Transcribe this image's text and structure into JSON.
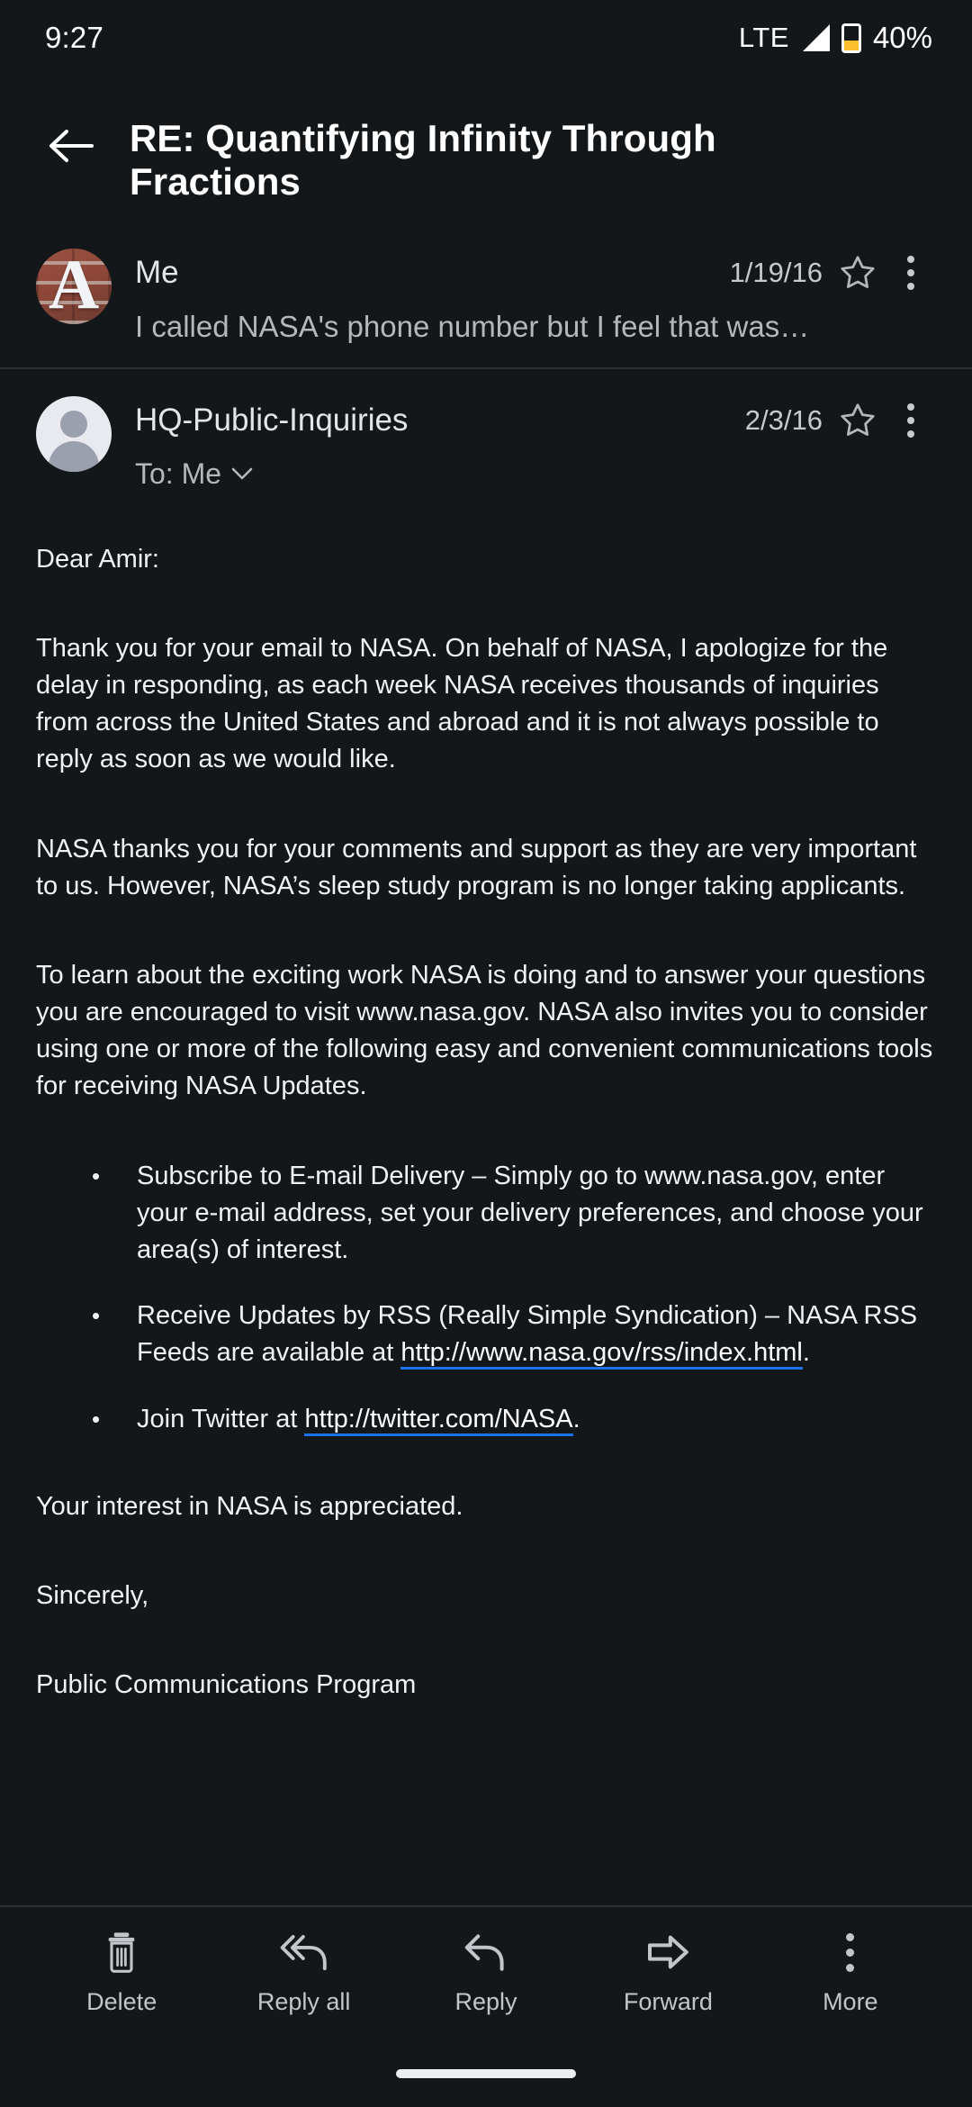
{
  "status_bar": {
    "time": "9:27",
    "network": "LTE",
    "battery_percent": "40%",
    "icons": [
      "signal-triangle-icon",
      "battery-icon"
    ],
    "battery_color": "#fdbf2d"
  },
  "header": {
    "back_icon": "arrow-back-icon",
    "subject": "RE: Quantifying Infinity Through Fractions"
  },
  "messages": [
    {
      "sender": "Me",
      "date": "1/19/16",
      "avatar_letter": "A",
      "avatar_type": "brick-photo-avatar",
      "snippet": "I called NASA's phone number but I feel that was…",
      "star_icon": "star-outline-icon",
      "menu_icon": "more-vert-icon",
      "expanded": false
    },
    {
      "sender": "HQ-Public-Inquiries",
      "date": "2/3/16",
      "avatar_type": "default-person-avatar",
      "recipients_label": "To: Me",
      "recipients_expand_icon": "chevron-down-icon",
      "star_icon": "star-outline-icon",
      "menu_icon": "more-vert-icon",
      "expanded": true
    }
  ],
  "body": {
    "greeting": "Dear Amir:",
    "paragraph_1": "Thank you for your email to NASA. On behalf of NASA, I apologize for the delay in responding, as each week NASA receives thousands of inquiries from across the United States and abroad and it is not always possible to reply as soon as we would like.",
    "paragraph_2": "NASA thanks you for your comments and support as they are very important to us.  However, NASA’s sleep study program is no longer taking applicants.",
    "paragraph_3": "To learn about the exciting work NASA is doing and to answer your questions you are encouraged to visit www.nasa.gov.  NASA also invites you to consider using one or more of the following easy and convenient communications tools for receiving NASA Updates.",
    "bullet_marker": "•",
    "bullet_1": "Subscribe to E-mail Delivery – Simply go to www.nasa.gov, enter your e-mail address, set your delivery preferences, and choose your area(s) of interest.",
    "bullet_2_before": "Receive Updates by RSS (Really Simple Syndication) – NASA RSS Feeds are available at ",
    "bullet_2_link": "http://www.nasa.gov/rss/index.html",
    "bullet_2_after": ".",
    "bullet_3_before": "Join Twitter at ",
    "bullet_3_link": "http://twitter.com/NASA",
    "bullet_3_after": ".",
    "closing_1": "Your interest in NASA is appreciated.",
    "closing_2": "Sincerely,",
    "signature": "Public Communications Program",
    "link_underline_color": "#1a73e8"
  },
  "toolbar": {
    "items": [
      {
        "label": "Delete",
        "icon": "trash-icon"
      },
      {
        "label": "Reply all",
        "icon": "reply-all-icon"
      },
      {
        "label": "Reply",
        "icon": "reply-icon"
      },
      {
        "label": "Forward",
        "icon": "forward-icon"
      },
      {
        "label": "More",
        "icon": "more-vert-icon"
      }
    ]
  },
  "nav_bar": {
    "gesture_pill": "home-gesture-pill"
  },
  "theme": {
    "background": "#131719",
    "primary_text": "#ffffff",
    "secondary_text": "#b4b8bd",
    "divider": "#2c3134"
  }
}
